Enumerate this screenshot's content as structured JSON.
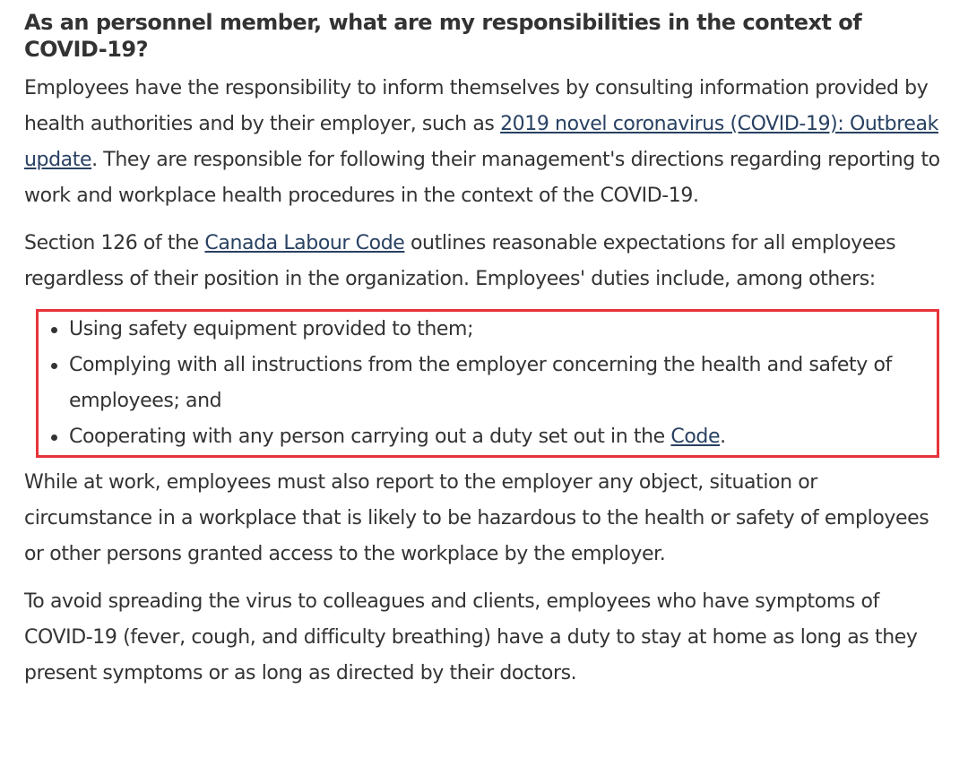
{
  "heading": "As an personnel member, what are my responsibilities in the context of COVID-19?",
  "para1": {
    "before": "Employees have the responsibility to inform themselves by consulting information provided by health authorities and by their employer, such as ",
    "link": "2019 novel coronavirus (COVID-19): Outbreak update",
    "after": ". They are responsible for following their management's directions regarding reporting to work and workplace health procedures in the context of the COVID-19."
  },
  "para2": {
    "before": "Section 126 of the ",
    "link": "Canada Labour Code",
    "after": " outlines reasonable expectations for all employees regardless of their position in the organization. Employees' duties include, among others:"
  },
  "duties": {
    "item1": "Using safety equipment provided to them;",
    "item2": "Complying with all instructions from the employer concerning the health and safety of employees; and",
    "item3_before": "Cooperating with any person carrying out a duty set out in the ",
    "item3_link": "Code",
    "item3_after": "."
  },
  "para3": "While at work, employees must also report to the employer any object, situation or circumstance in a workplace that is likely to be hazardous to the health or safety of employees or other persons granted access to the workplace by the employer.",
  "para4": "To avoid spreading the virus to colleagues and clients, employees who have symptoms of COVID-19 (fever, cough, and difficulty breathing) have a duty to stay at home as long as they present symptoms or as long as directed by their doctors.",
  "colors": {
    "text": "#333333",
    "link": "#284162",
    "highlight_border": "#e8333a"
  }
}
